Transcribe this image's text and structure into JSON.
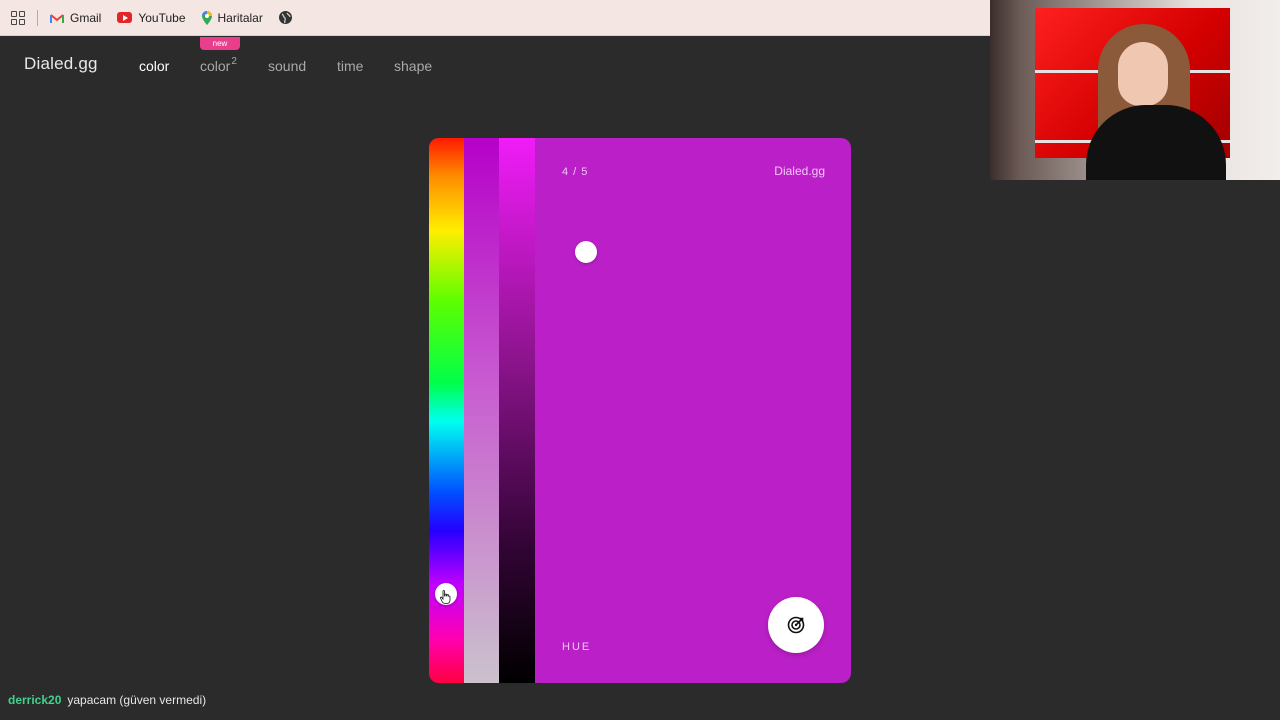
{
  "bookmarks": {
    "items": [
      {
        "label": "Gmail",
        "icon": "gmail-icon"
      },
      {
        "label": "YouTube",
        "icon": "youtube-icon"
      },
      {
        "label": "Haritalar",
        "icon": "maps-icon"
      }
    ]
  },
  "header": {
    "logo": "Dialed.gg",
    "nav": {
      "color": "color",
      "color2": "color",
      "color2_sup": "2",
      "color2_badge": "new",
      "sound": "sound",
      "time": "time",
      "shape": "shape"
    },
    "active_tab": "color"
  },
  "game": {
    "progress": "4 / 5",
    "brand": "Dialed.gg",
    "slider_label": "HUE",
    "current_color": "#bb20c8",
    "sliders": {
      "hue": 0.82,
      "saturation": 0.27,
      "brightness": 0.21
    },
    "submit_icon": "target-icon"
  },
  "chat": {
    "user": "derrick20",
    "message": "yapacam (güven vermedi)",
    "user_color": "#3fd28b"
  }
}
